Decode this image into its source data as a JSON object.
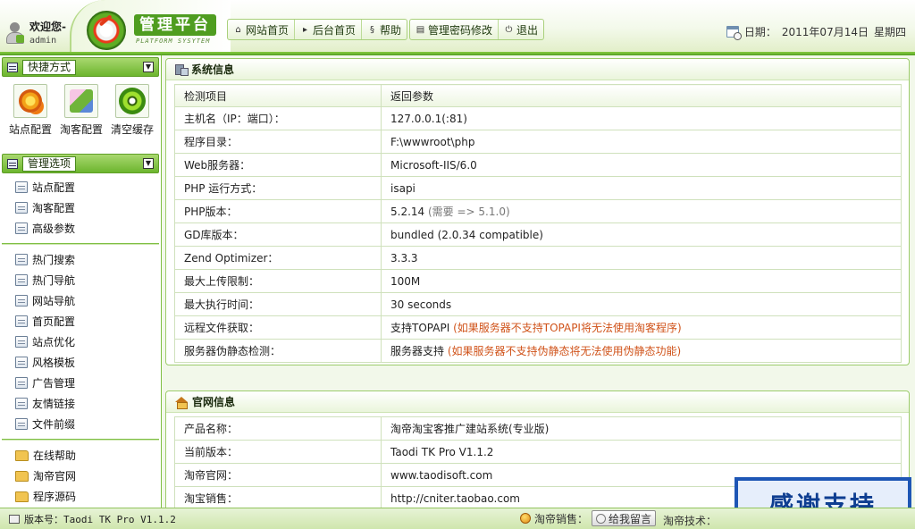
{
  "header": {
    "welcome": "欢迎您-",
    "user": "admin",
    "logo_title": "管理平台",
    "logo_sub": "PLATFORM SYSYTEM",
    "nav_group1": [
      {
        "label": "网站首页",
        "icon": "home-icon"
      },
      {
        "label": "后台首页",
        "icon": "play-icon"
      },
      {
        "label": "帮助",
        "icon": "help-icon"
      }
    ],
    "nav_group2": [
      {
        "label": "管理密码修改",
        "icon": "list-icon"
      },
      {
        "label": "退出",
        "icon": "power-icon"
      }
    ],
    "date_label": "日期：",
    "date_value": "2011年07月14日",
    "weekday": "星期四"
  },
  "sidebar": {
    "quick_title": "快捷方式",
    "quick_items": [
      {
        "label": "站点配置",
        "icon": "gears-icon"
      },
      {
        "label": "淘客配置",
        "icon": "taoke-settings-icon"
      },
      {
        "label": "清空缓存",
        "icon": "clear-cache-icon"
      }
    ],
    "manage_title": "管理选项",
    "group1": [
      "站点配置",
      "淘客配置",
      "高级参数"
    ],
    "group2": [
      "热门搜索",
      "热门导航",
      "网站导航",
      "首页配置",
      "站点优化",
      "风格模板",
      "广告管理",
      "友情链接",
      "文件前缀"
    ],
    "group3": [
      "在线帮助",
      "淘帝官网",
      "程序源码"
    ]
  },
  "system_panel": {
    "title": "系统信息",
    "col1": "检测项目",
    "col2": "返回参数",
    "rows": [
      {
        "k": "主机名（IP：端口）：",
        "v": "127.0.0.1(:81)",
        "note": ""
      },
      {
        "k": "程序目录：",
        "v": "F:\\wwwroot\\php",
        "note": ""
      },
      {
        "k": "Web服务器：",
        "v": "Microsoft-IIS/6.0",
        "note": ""
      },
      {
        "k": "PHP 运行方式：",
        "v": "isapi",
        "note": ""
      },
      {
        "k": "PHP版本：",
        "v": "5.2.14",
        "note": "(需要 => 5.1.0)"
      },
      {
        "k": "GD库版本：",
        "v": "bundled (2.0.34 compatible)",
        "note": ""
      },
      {
        "k": "Zend Optimizer：",
        "v": "3.3.3",
        "note": ""
      },
      {
        "k": "最大上传限制：",
        "v": "100M",
        "note": ""
      },
      {
        "k": "最大执行时间：",
        "v": "30 seconds",
        "note": ""
      },
      {
        "k": "远程文件获取：",
        "v": "支持TOPAPI",
        "warn": "(如果服务器不支持TOPAPI将无法使用淘客程序)"
      },
      {
        "k": "服务器伪静态检测：",
        "v": "服务器支持",
        "warn": "(如果服务器不支持伪静态将无法使用伪静态功能)"
      }
    ]
  },
  "official_panel": {
    "title": "官网信息",
    "rows": [
      {
        "k": "产品名称：",
        "v": "淘帝淘宝客推广建站系统(专业版)"
      },
      {
        "k": "当前版本：",
        "v": "Taodi TK Pro V1.1.2"
      },
      {
        "k": "淘帝官网：",
        "v": "www.taodisoft.com"
      },
      {
        "k": "淘宝销售：",
        "v": "http://cniter.taobao.com"
      }
    ]
  },
  "thanks_banner": "感谢支持",
  "footer": {
    "version_label": "版本号：Taodi TK Pro V1.1.2",
    "sales_label": "淘帝销售：",
    "msg_button": "给我留言",
    "tech_label": "淘帝技术："
  },
  "colors": {
    "accent": "#6cb52e",
    "warn": "#d0531a",
    "banner": "#1e56b5"
  }
}
